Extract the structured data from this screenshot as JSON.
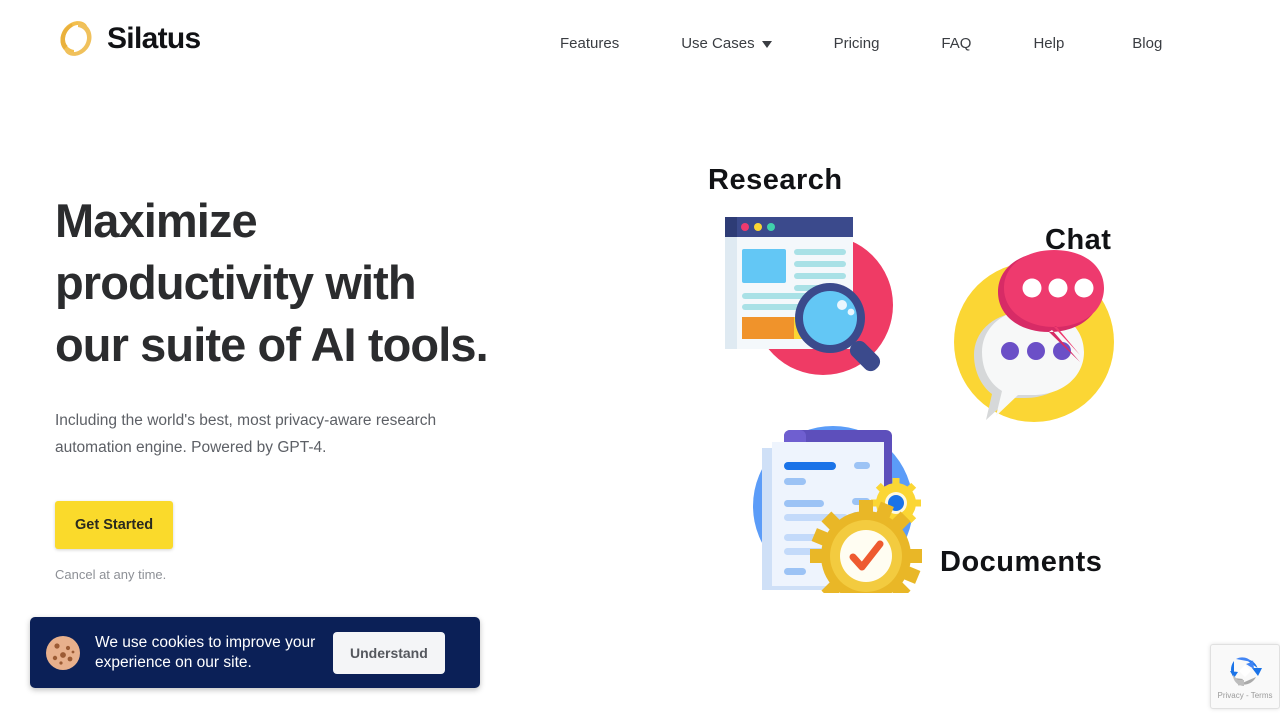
{
  "brand": {
    "name": "Silatus",
    "logo_icon": "silatus-s-logo",
    "logo_color": "#f5c04a"
  },
  "nav": {
    "items": [
      {
        "label": "Features",
        "has_dropdown": false
      },
      {
        "label": "Use Cases",
        "has_dropdown": true,
        "icon": "chevron-down-icon"
      },
      {
        "label": "Pricing",
        "has_dropdown": false
      },
      {
        "label": "FAQ",
        "has_dropdown": false
      },
      {
        "label": "Help",
        "has_dropdown": false
      },
      {
        "label": "Blog",
        "has_dropdown": false
      }
    ]
  },
  "hero": {
    "headline_line1": "Maximize",
    "headline_line2": "productivity with",
    "headline_line3": "our suite of AI tools.",
    "subtitle": "Including the world's best, most privacy-aware research automation engine. Powered by GPT-4.",
    "cta_label": "Get Started",
    "cta_color": "#fada2b",
    "cancel_note": "Cancel at any time."
  },
  "illustration": {
    "labels": {
      "research": "Research",
      "chat": "Chat",
      "documents": "Documents"
    },
    "icons": {
      "research": "research-magnifier-browser-icon",
      "chat": "chat-speech-bubbles-icon",
      "documents": "documents-gear-check-icon"
    },
    "colors": {
      "research_circle": "#ef3b65",
      "chat_circle": "#fbd634",
      "documents_circle": "#5b9cf8",
      "chat_bubble_pink": "#ee3a6e",
      "gear_gold": "#e9b727"
    }
  },
  "cookie_banner": {
    "icon": "cookie-icon",
    "message": "We use cookies to improve your experience on our site.",
    "accept_label": "Understand",
    "background": "#0b2057"
  },
  "recaptcha": {
    "icon": "recaptcha-arrows-icon",
    "text": "Privacy - Terms"
  }
}
